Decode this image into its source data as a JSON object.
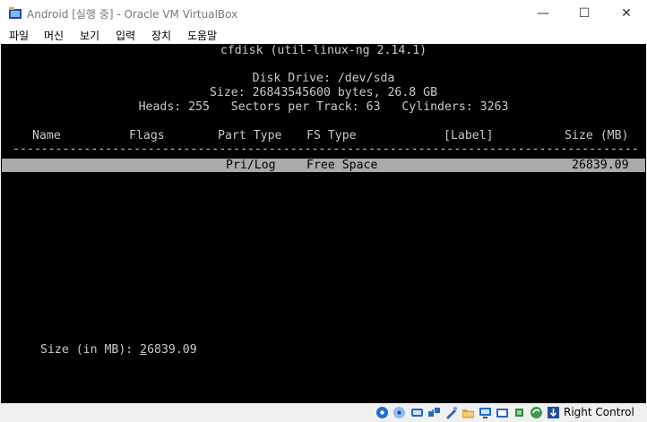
{
  "window": {
    "title": "Android [실행 중] - Oracle VM VirtualBox",
    "controls": {
      "minimize": "—",
      "maximize": "☐",
      "close": "✕"
    }
  },
  "menu": [
    "파일",
    "머신",
    "보기",
    "입력",
    "장치",
    "도움말"
  ],
  "cfdisk": {
    "title": "cfdisk (util-linux-ng 2.14.1)",
    "disk_drive": "Disk Drive: /dev/sda",
    "size_line": "Size: 26843545600 bytes, 26.8 GB",
    "geometry": "Heads: 255   Sectors per Track: 63   Cylinders: 3263",
    "columns": {
      "name": "Name",
      "flags": "Flags",
      "part_type": "Part Type",
      "fs_type": "FS Type",
      "label": "[Label]",
      "size": "Size (MB)"
    },
    "separator": "------------------------------------------------------------------------------------------",
    "rows": [
      {
        "part_type": "Pri/Log",
        "fs_type": "Free Space",
        "size": "26839.09"
      }
    ],
    "prompt_label": "Size (in MB): ",
    "prompt_first": "2",
    "prompt_rest": "6839.09"
  },
  "statusbar": {
    "icons": [
      "hard-disk-icon",
      "optical-drive-icon",
      "audio-icon",
      "network-icon",
      "usb-icon",
      "shared-folder-icon",
      "display-icon",
      "video-capture-icon",
      "cpu-icon",
      "mouse-integration-icon",
      "keyboard-capture-icon"
    ],
    "host_key": "Right Control"
  }
}
